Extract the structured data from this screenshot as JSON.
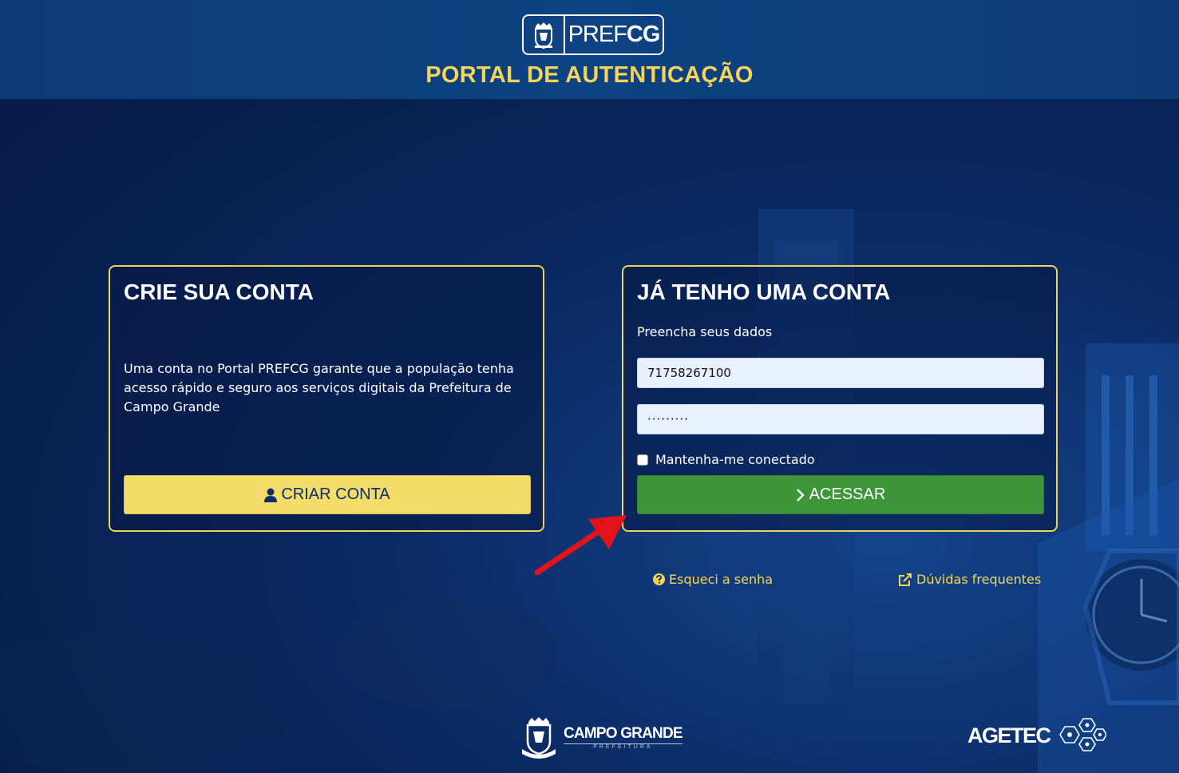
{
  "header": {
    "logo_text_regular": "PREF",
    "logo_text_bold": "CG",
    "title": "PORTAL DE AUTENTICAÇÃO"
  },
  "create_card": {
    "title": "CRIE SUA CONTA",
    "description": "Uma conta no Portal PREFCG garante que a população tenha acesso rápido e seguro aos serviços digitais da Prefeitura de Campo Grande",
    "button_label": "CRIAR CONTA",
    "button_icon": "user-icon"
  },
  "login_card": {
    "title": "JÁ TENHO UMA CONTA",
    "subtitle": "Preencha seus dados",
    "username_value": "71758267100",
    "password_value": "·········",
    "remember_label": "Mantenha-me conectado",
    "remember_checked": false,
    "button_label": "ACESSAR",
    "button_icon": "chevron-right-icon"
  },
  "links": {
    "forgot_label": "Esqueci a senha",
    "forgot_icon": "question-circle-icon",
    "faq_label": "Dúvidas frequentes",
    "faq_icon": "external-link-icon"
  },
  "footer": {
    "cg_name": "CAMPO GRANDE",
    "cg_sub": "PREFEITURA",
    "agetec": "AGETEC"
  },
  "colors": {
    "accent_yellow": "#f4d557",
    "button_green": "#3f953a",
    "button_yellow": "#f4dc6a",
    "background": "#0b2a63"
  }
}
